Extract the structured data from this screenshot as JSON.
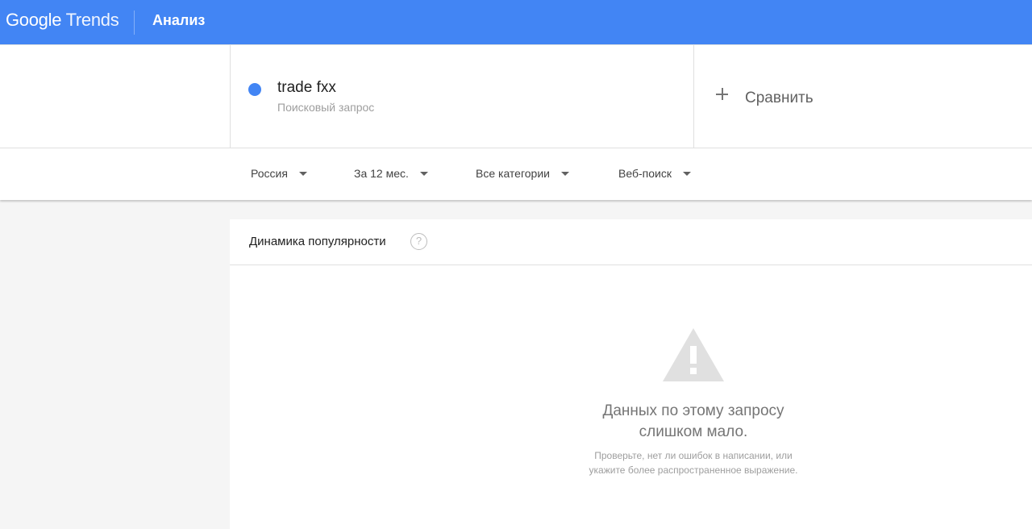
{
  "header": {
    "logo_google": "Google",
    "logo_trends": "Trends",
    "title": "Анализ"
  },
  "query": {
    "term": "trade fxx",
    "term_type": "Поисковый запрос",
    "term_color": "#4285f4",
    "compare_label": "Сравнить"
  },
  "filters": {
    "region": "Россия",
    "period": "За 12 мес.",
    "category": "Все категории",
    "search_type": "Веб-поиск"
  },
  "card": {
    "title": "Динамика популярности",
    "help_glyph": "?",
    "empty_title_line1": "Данных по этому запросу",
    "empty_title_line2": "слишком мало.",
    "empty_sub_line1": "Проверьте, нет ли ошибок в написании, или",
    "empty_sub_line2": "укажите более распространенное выражение."
  },
  "colors": {
    "brand": "#4285f4",
    "warning_icon": "#e0e0e0"
  }
}
